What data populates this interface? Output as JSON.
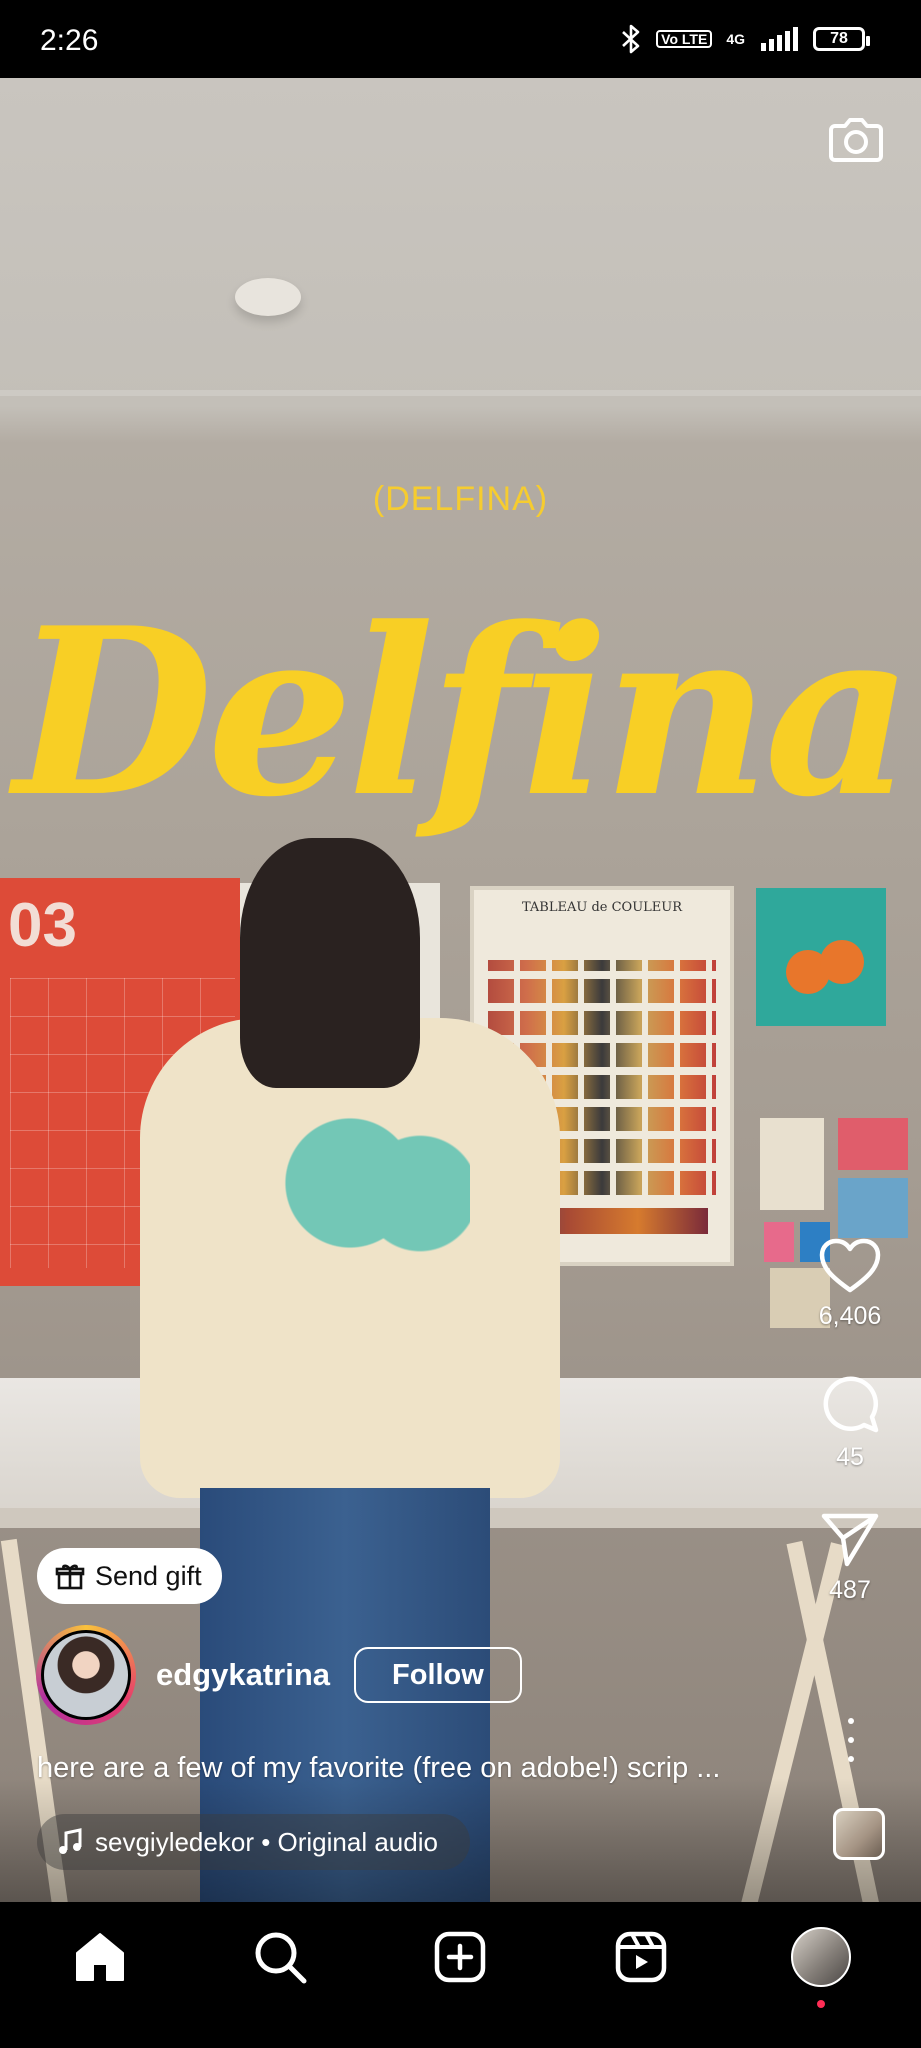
{
  "status_bar": {
    "time": "2:26",
    "network_badge": "Vo LTE",
    "network_type": "4G",
    "battery": "78"
  },
  "video": {
    "overlay_small": "(DELFINA)",
    "overlay_big": "Delfina",
    "calendar_number": "03",
    "poster_heading": "TABLEAU de COULEUR"
  },
  "actions": {
    "likes": "6,406",
    "comments": "45",
    "shares": "487"
  },
  "post": {
    "send_gift_label": "Send gift",
    "username": "edgykatrina",
    "follow_label": "Follow",
    "caption": "here are a few of my favorite (free on adobe!) scrip ...",
    "audio": "sevgiyledekor • Original audio"
  },
  "icons": {
    "camera": "camera-icon",
    "like": "heart-icon",
    "comment": "comment-icon",
    "share": "paper-plane-icon",
    "more": "more-vertical-icon",
    "gift": "gift-icon",
    "music": "music-note-icon",
    "home": "home-icon",
    "search": "search-icon",
    "create": "plus-square-icon",
    "reels": "reels-icon"
  },
  "colors": {
    "title_yellow": "#f8cf25",
    "notification_dot": "#ff2d55"
  }
}
